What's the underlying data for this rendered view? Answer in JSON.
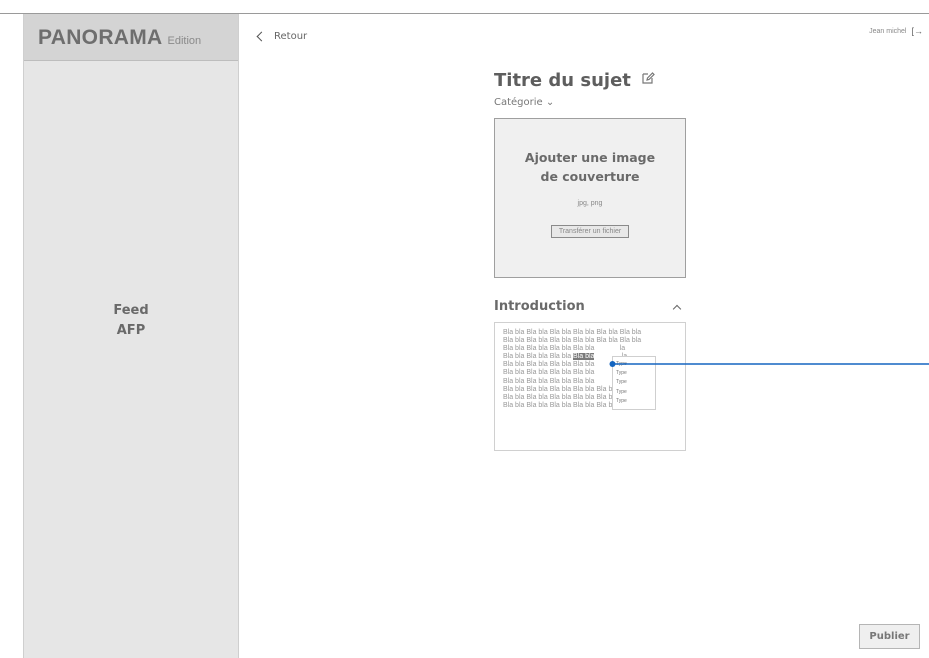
{
  "sidebar": {
    "brand_name": "PANORAMA",
    "brand_edition": "Edition",
    "feed_line1": "Feed",
    "feed_line2": "AFP"
  },
  "header": {
    "back_label": "Retour",
    "user_name": "Jean michel",
    "logout_icon": "logout-icon"
  },
  "subject": {
    "title": "Titre du sujet",
    "category_label": "Catégorie",
    "category_chevron": "⌄"
  },
  "cover": {
    "title_line1": "Ajouter une image",
    "title_line2": "de couverture",
    "formats": "jpg, png",
    "upload_label": "Transférer un fichier"
  },
  "introduction": {
    "title": "Introduction",
    "lines": [
      {
        "before": "Bla bla Bla bla Bla bla Bla bla Bla bla Bla bla",
        "highlight": "",
        "after": ""
      },
      {
        "before": "Bla bla Bla bla Bla bla Bla bla Bla bla Bla bla",
        "highlight": "",
        "after": ""
      },
      {
        "before": "Bla bla Bla bla Bla bla Bla bla",
        "highlight": "",
        "after": "             la"
      },
      {
        "before": "Bla bla Bla bla Bla bla ",
        "highlight": "Bla bla",
        "after": "              la"
      },
      {
        "before": "Bla bla Bla bla Bla bla Bla bla",
        "highlight": "",
        "after": "             la"
      },
      {
        "before": "Bla bla Bla bla Bla bla Bla bla",
        "highlight": "",
        "after": "             la"
      },
      {
        "before": "Bla bla Bla bla Bla bla Bla bla",
        "highlight": "",
        "after": "             la"
      },
      {
        "before": "Bla bla Bla bla Bla bla Bla bla Bla bla Bla bla",
        "highlight": "",
        "after": ""
      },
      {
        "before": "Bla bla Bla bla Bla bla Bla bla Bla bla Bla bla",
        "highlight": "",
        "after": ""
      },
      {
        "before": "Bla bla Bla bla Bla bla Bla bla Bla bla",
        "highlight": "",
        "after": ""
      }
    ],
    "type_menu": [
      "Type",
      "Type",
      "Type",
      "Type",
      "Type"
    ]
  },
  "footer": {
    "publish_label": "Publier"
  },
  "colors": {
    "connector": "#1565c0",
    "sidebar_bg": "#e6e6e6",
    "brand_bg": "#d4d4d4"
  }
}
